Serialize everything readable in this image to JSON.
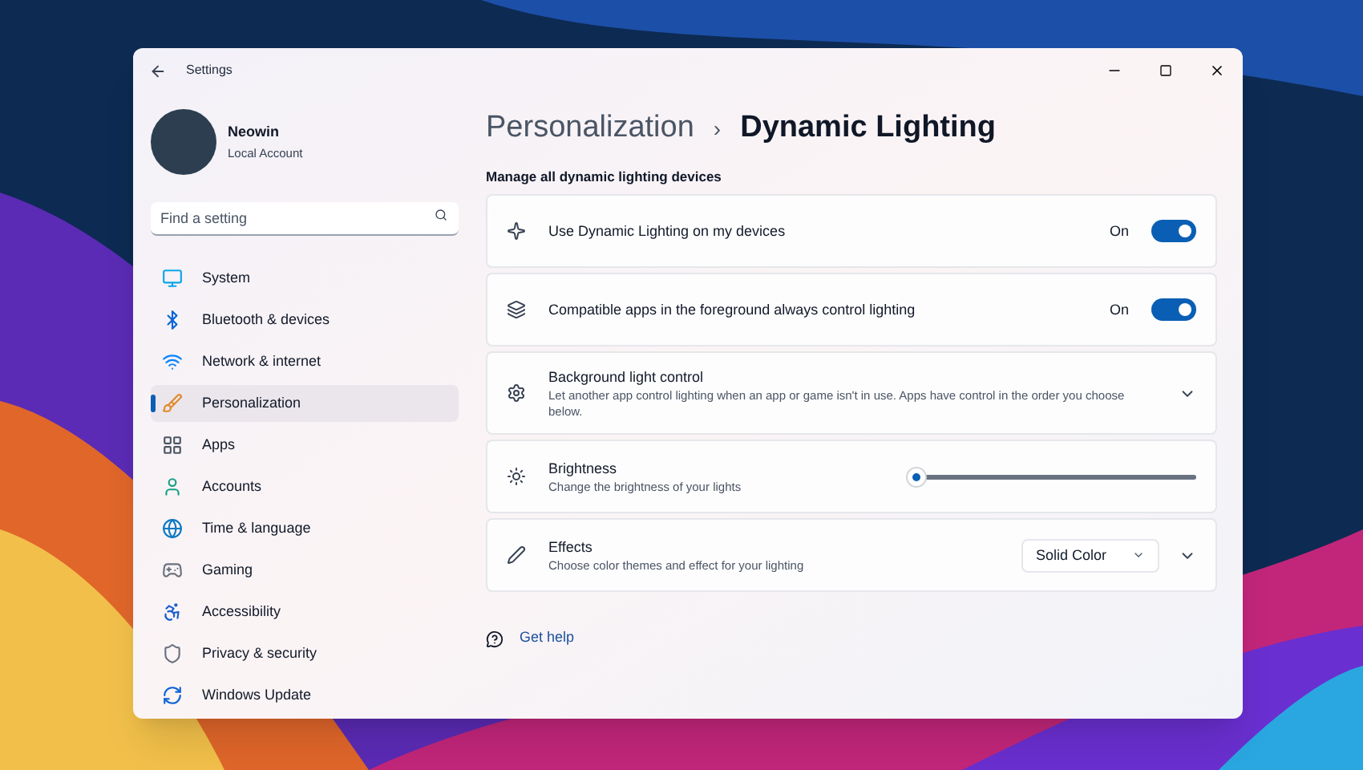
{
  "window": {
    "title": "Settings"
  },
  "account": {
    "name": "Neowin",
    "type": "Local Account"
  },
  "search": {
    "placeholder": "Find a setting"
  },
  "nav": [
    {
      "label": "System",
      "selected": false
    },
    {
      "label": "Bluetooth & devices",
      "selected": false
    },
    {
      "label": "Network & internet",
      "selected": false
    },
    {
      "label": "Personalization",
      "selected": true
    },
    {
      "label": "Apps",
      "selected": false
    },
    {
      "label": "Accounts",
      "selected": false
    },
    {
      "label": "Time & language",
      "selected": false
    },
    {
      "label": "Gaming",
      "selected": false
    },
    {
      "label": "Accessibility",
      "selected": false
    },
    {
      "label": "Privacy & security",
      "selected": false
    },
    {
      "label": "Windows Update",
      "selected": false
    }
  ],
  "breadcrumb": {
    "parent": "Personalization",
    "separator": "›",
    "current": "Dynamic Lighting"
  },
  "section_title": "Manage all dynamic lighting devices",
  "settings": [
    {
      "kind": "toggle",
      "title": "Use Dynamic Lighting on my devices",
      "state_text": "On",
      "on": true
    },
    {
      "kind": "toggle",
      "title": "Compatible apps in the foreground always control lighting",
      "state_text": "On",
      "on": true
    },
    {
      "kind": "expand",
      "title": "Background light control",
      "description": "Let another app control lighting when an app or game isn't in use. Apps have control in the order you choose below.",
      "expanded": false
    },
    {
      "kind": "slider",
      "title": "Brightness",
      "description": "Change the brightness of your lights",
      "level": 0
    },
    {
      "kind": "dropdown",
      "title": "Effects",
      "description": "Choose color themes and effect for your lighting",
      "value": "Solid Color",
      "expanded": false
    }
  ],
  "help_link": "Get help"
}
